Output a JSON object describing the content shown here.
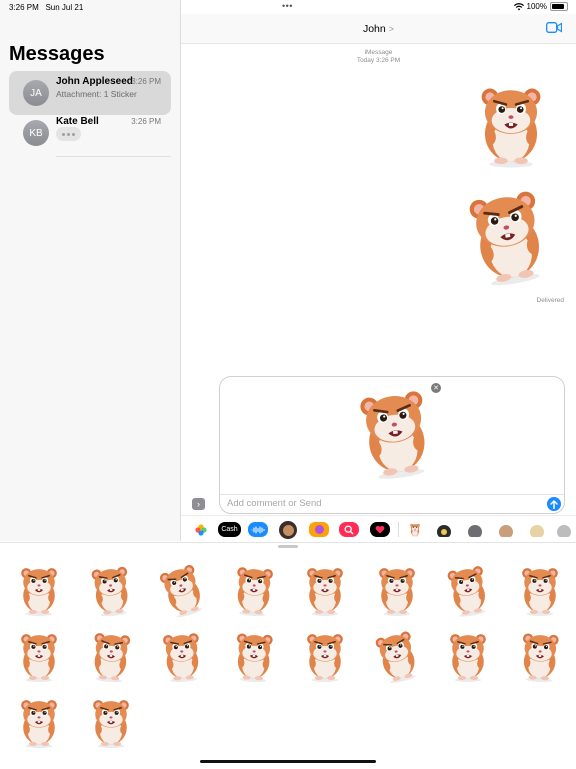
{
  "status_bar": {
    "time": "3:26 PM",
    "date": "Sun Jul 21",
    "battery": "100%"
  },
  "sidebar": {
    "title": "Messages",
    "conversations": [
      {
        "initials": "JA",
        "name": "John Appleseed",
        "time": "3:26 PM",
        "preview": "Attachment: 1 Sticker",
        "selected": true
      },
      {
        "initials": "KB",
        "name": "Kate Bell",
        "time": "3:26 PM",
        "preview": "",
        "typing": true
      }
    ]
  },
  "chat": {
    "contact": "John",
    "service": "iMessage",
    "timestamp": "Today 3:26 PM",
    "status": "Delivered"
  },
  "compose": {
    "placeholder": "Add comment or Send"
  },
  "app_drawer": {
    "apps": [
      "photos-icon",
      "apple-cash-icon",
      "audio-message-icon",
      "memoji-icon",
      "stickers-icon",
      "search-images-icon",
      "digital-touch-icon",
      "hamster-sticker-icon",
      "sticker-app-icon",
      "sticker-app-icon",
      "sticker-app-icon",
      "sticker-app-icon",
      "sticker-app-icon"
    ],
    "apple_pay_label": "Cash"
  },
  "sticker_panel": {
    "sticker_count": 18
  },
  "colors": {
    "accent": "#1a8cff",
    "fur": "#e0844a",
    "belly": "#f6ece4"
  }
}
